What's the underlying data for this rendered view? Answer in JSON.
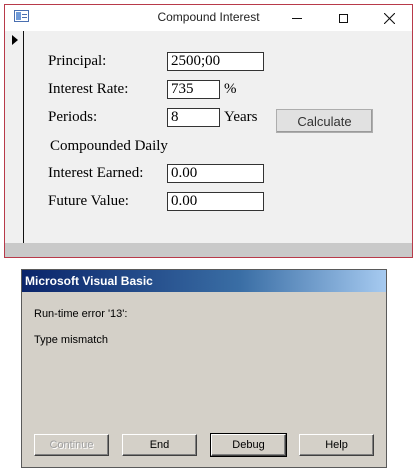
{
  "ci_window": {
    "title": "Compound Interest",
    "labels": {
      "principal": "Principal:",
      "interest_rate": "Interest Rate:",
      "percent": "%",
      "periods": "Periods:",
      "years": "Years",
      "compounded": "Compounded Daily",
      "interest_earned": "Interest Earned:",
      "future_value": "Future Value:"
    },
    "fields": {
      "principal": "2500;00",
      "interest_rate": "735",
      "periods": "8",
      "interest_earned": "0.00",
      "future_value": "0.00"
    },
    "calculate_label": "Calculate",
    "window_buttons": {
      "minimize": "minimize-icon",
      "maximize": "maximize-icon",
      "close": "close-icon"
    }
  },
  "vb_dialog": {
    "title": "Microsoft Visual Basic",
    "error_line": "Run-time error '13':",
    "message": "Type mismatch",
    "buttons": {
      "continue": "Continue",
      "end": "End",
      "debug": "Debug",
      "help": "Help"
    }
  },
  "colors": {
    "window_border": "#b83a4a",
    "dialog_face": "#d4d0c8",
    "dialog_title_start": "#0a246a",
    "dialog_title_end": "#a6caf0"
  }
}
